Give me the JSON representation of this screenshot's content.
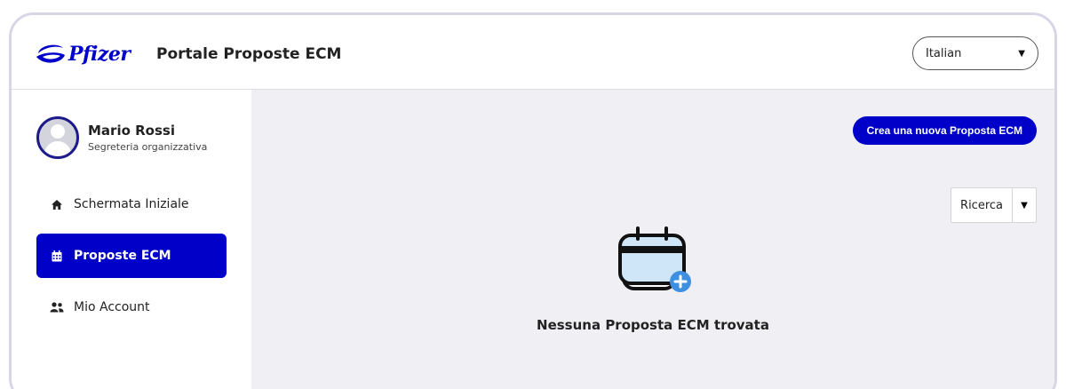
{
  "header": {
    "logo_text": "Pfizer",
    "app_title": "Portale Proposte ECM",
    "language": {
      "selected": "Italian"
    }
  },
  "user": {
    "name": "Mario Rossi",
    "role": "Segreteria organizzativa"
  },
  "sidebar": {
    "items": [
      {
        "label": "Schermata Iniziale",
        "icon": "home-icon",
        "active": false
      },
      {
        "label": "Proposte ECM",
        "icon": "calendar-icon",
        "active": true
      },
      {
        "label": "Mio Account",
        "icon": "users-icon",
        "active": false
      }
    ]
  },
  "main": {
    "create_button": "Crea una nuova Proposta ECM",
    "search_label": "Ricerca",
    "empty_message": "Nessuna Proposta ECM trovata"
  },
  "colors": {
    "brand_blue": "#0000c9",
    "background": "#f0f0f4",
    "add_badge": "#3f8fe0",
    "icon_fill": "#cfe6f8"
  }
}
